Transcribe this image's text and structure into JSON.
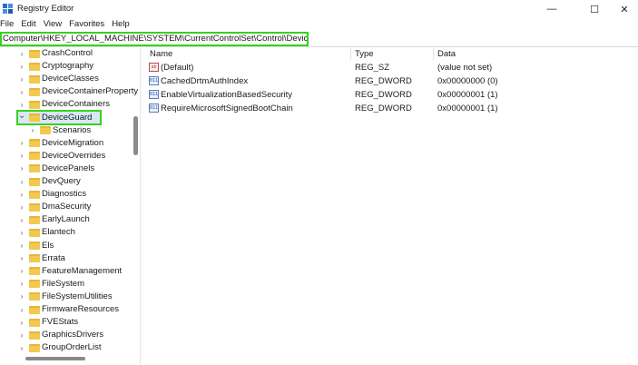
{
  "window": {
    "title": "Registry Editor",
    "controls": {
      "minimize": "—",
      "maximize": "☐",
      "close": "✕"
    }
  },
  "menu": [
    "File",
    "Edit",
    "View",
    "Favorites",
    "Help"
  ],
  "address": {
    "value": "Computer\\HKEY_LOCAL_MACHINE\\SYSTEM\\CurrentControlSet\\Control\\DeviceGuard"
  },
  "tree": {
    "items": [
      {
        "label": "CrashControl",
        "expanded": false
      },
      {
        "label": "Cryptography",
        "expanded": false
      },
      {
        "label": "DeviceClasses",
        "expanded": false
      },
      {
        "label": "DeviceContainerProperty",
        "expanded": false
      },
      {
        "label": "DeviceContainers",
        "expanded": false
      },
      {
        "label": "DeviceGuard",
        "expanded": true,
        "selected": true
      },
      {
        "label": "Scenarios",
        "expanded": false,
        "child": true
      },
      {
        "label": "DeviceMigration",
        "expanded": false
      },
      {
        "label": "DeviceOverrides",
        "expanded": false
      },
      {
        "label": "DevicePanels",
        "expanded": false
      },
      {
        "label": "DevQuery",
        "expanded": false
      },
      {
        "label": "Diagnostics",
        "expanded": false
      },
      {
        "label": "DmaSecurity",
        "expanded": false
      },
      {
        "label": "EarlyLaunch",
        "expanded": false
      },
      {
        "label": "Elantech",
        "expanded": false
      },
      {
        "label": "Els",
        "expanded": false
      },
      {
        "label": "Errata",
        "expanded": false
      },
      {
        "label": "FeatureManagement",
        "expanded": false
      },
      {
        "label": "FileSystem",
        "expanded": false
      },
      {
        "label": "FileSystemUtilities",
        "expanded": false
      },
      {
        "label": "FirmwareResources",
        "expanded": false
      },
      {
        "label": "FVEStats",
        "expanded": false
      },
      {
        "label": "GraphicsDrivers",
        "expanded": false
      },
      {
        "label": "GroupOrderList",
        "expanded": false
      }
    ]
  },
  "list": {
    "columns": {
      "name": "Name",
      "type": "Type",
      "data": "Data"
    },
    "rows": [
      {
        "icon": "ab",
        "name": "(Default)",
        "type": "REG_SZ",
        "data": "(value not set)"
      },
      {
        "icon": "011",
        "name": "CachedDrtmAuthIndex",
        "type": "REG_DWORD",
        "data": "0x00000000 (0)"
      },
      {
        "icon": "011",
        "name": "EnableVirtualizationBasedSecurity",
        "type": "REG_DWORD",
        "data": "0x00000001 (1)"
      },
      {
        "icon": "011",
        "name": "RequireMicrosoftSignedBootChain",
        "type": "REG_DWORD",
        "data": "0x00000001 (1)"
      }
    ]
  },
  "colors": {
    "highlight": "#38d11f",
    "selection": "#d8e8f6",
    "folder": "#f2c94c"
  }
}
